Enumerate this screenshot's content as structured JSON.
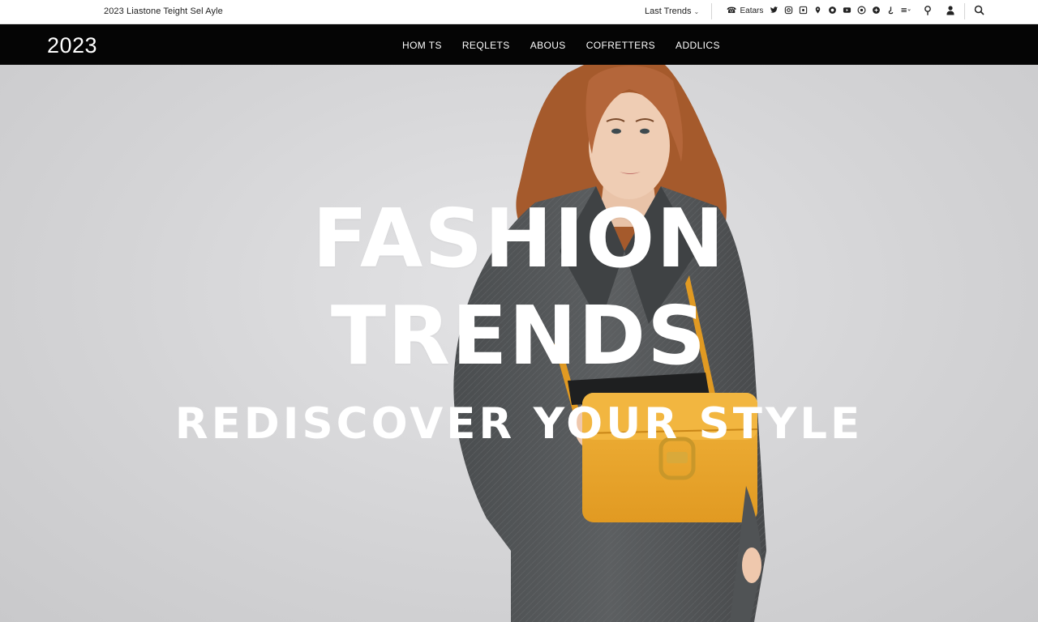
{
  "topbar": {
    "tagline": "2023 Liastone Teight Sel Ayle",
    "trends_select": "Last Trends",
    "phone_label": "Eatars",
    "social_icons": [
      "twitter-icon",
      "instagram-icon",
      "pinterest-icon",
      "tiktok-icon",
      "facebook-icon",
      "youtube-icon",
      "snapchat-icon",
      "whatsapp-icon",
      "threads-icon",
      "more-icon"
    ],
    "util_icons": [
      "location-icon",
      "account-icon",
      "search-icon"
    ]
  },
  "nav": {
    "logo": "2023",
    "items": [
      "HOM TS",
      "REQLETS",
      "ABOUS",
      "COFRETTERS",
      "ADDLICS"
    ]
  },
  "hero": {
    "line1": "FASHION",
    "line2": "TRENDS",
    "subtitle": "REDISCOVER YOUR STYLE",
    "colors": {
      "background": "#d6d6d8",
      "coat": "#55585a",
      "bag": "#eaa52b",
      "hair": "#a55a2c",
      "text": "#ffffff"
    }
  }
}
